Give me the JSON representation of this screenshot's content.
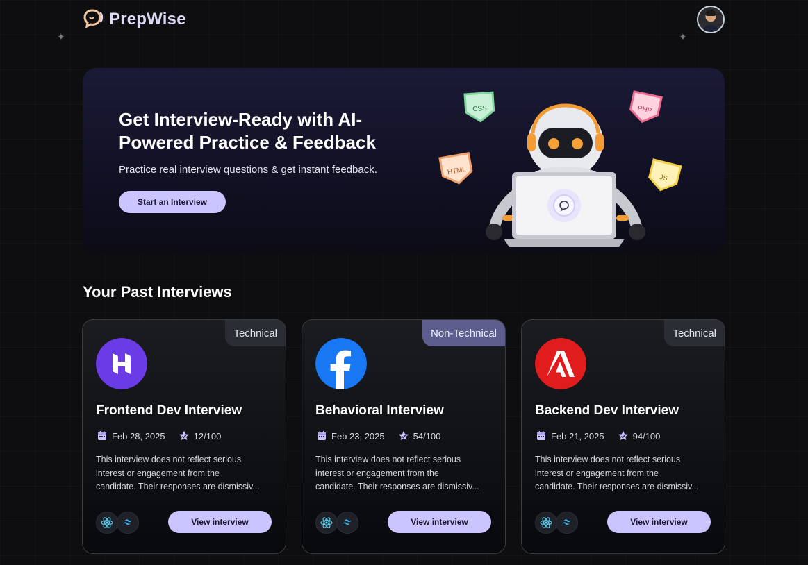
{
  "app": {
    "name": "PrepWise"
  },
  "icons": {
    "logo": "chat-bubble-icon",
    "avatar": "user-avatar",
    "calendar": "calendar-icon",
    "star": "star-icon",
    "react": "react-icon",
    "tailwind": "tailwind-icon"
  },
  "colors": {
    "accent": "#cac5fe",
    "logo_text": "#dcd9f5",
    "badge_technical": "#2b2d35",
    "badge_non_technical": "#5d5e8e",
    "background": "#0e0e10"
  },
  "hero": {
    "title": "Get Interview-Ready with AI-Powered Practice & Feedback",
    "subtitle": "Practice real interview questions & get instant feedback.",
    "cta_label": "Start an Interview",
    "badges": [
      "CSS",
      "PHP",
      "HTML",
      "JS"
    ]
  },
  "section": {
    "title": "Your Past Interviews"
  },
  "interviews": [
    {
      "badge": "Technical",
      "company_icon": "hostinger-logo",
      "title": "Frontend Dev Interview",
      "date": "Feb 28, 2025",
      "score": "12/100",
      "description": [
        "This interview does not reflect serious",
        "interest or engagement from the",
        "candidate. Their responses are dismissiv..."
      ],
      "cta_label": "View interview"
    },
    {
      "badge": "Non-Technical",
      "company_icon": "facebook-logo",
      "title": "Behavioral Interview",
      "date": "Feb 23, 2025",
      "score": "54/100",
      "description": [
        "This interview does not reflect serious",
        "interest or engagement from the",
        "candidate. Their responses are dismissiv..."
      ],
      "cta_label": "View interview"
    },
    {
      "badge": "Technical",
      "company_icon": "adobe-logo",
      "title": "Backend Dev Interview",
      "date": "Feb 21, 2025",
      "score": "94/100",
      "description": [
        "This interview does not reflect serious",
        "interest or engagement from the",
        "candidate. Their responses are dismissiv..."
      ],
      "cta_label": "View interview"
    }
  ]
}
